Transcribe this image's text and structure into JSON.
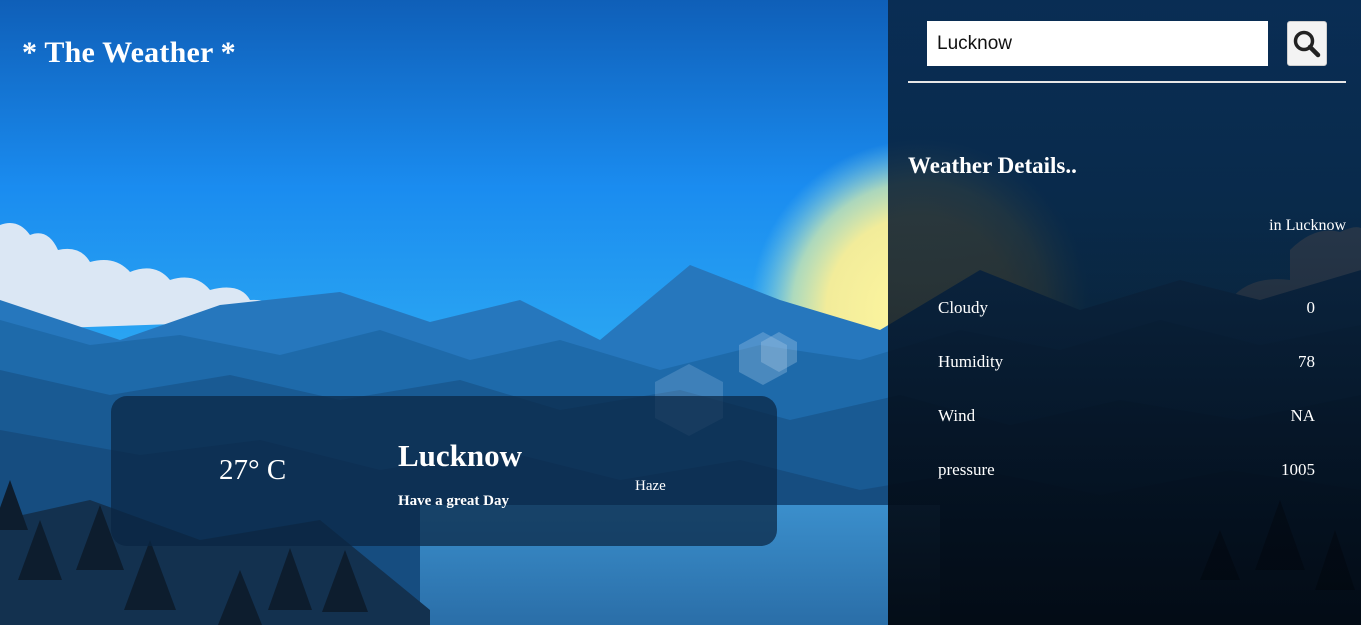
{
  "header": {
    "title": "* The Weather *"
  },
  "current": {
    "temperature": "27° C",
    "city": "Lucknow",
    "greeting": "Have a great Day",
    "condition": "Haze"
  },
  "search": {
    "value": "Lucknow",
    "icon": "search-icon"
  },
  "details": {
    "title": "Weather Details..",
    "location": "in Lucknow",
    "rows": [
      {
        "label": "Cloudy",
        "value": "0"
      },
      {
        "label": "Humidity",
        "value": "78"
      },
      {
        "label": "Wind",
        "value": "NA"
      },
      {
        "label": "pressure",
        "value": "1005"
      }
    ]
  },
  "colors": {
    "sky_top": "#0f5fb8",
    "sky_mid": "#1990f0",
    "panel": "#061a2e",
    "text": "#ffffff"
  }
}
